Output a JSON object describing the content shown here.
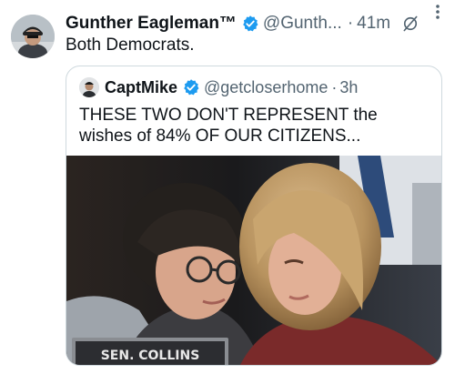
{
  "tweet": {
    "author_name": "Gunther Eagleman™",
    "handle": "@Gunth...",
    "separator": "·",
    "time": "41m",
    "text": "Both Democrats."
  },
  "quoted": {
    "author_name": "CaptMike",
    "handle": "@getcloserhome",
    "separator": "·",
    "time": "3h",
    "text": "THESE TWO DON'T REPRESENT the wishes of 84% OF OUR CITIZENS...",
    "photo": {
      "nameplate": "SEN. COLLINS"
    }
  },
  "icons": {
    "verified": "verified-badge-icon",
    "grok": "grok-icon",
    "more": "more-options-icon"
  },
  "colors": {
    "verified": "#1d9bf0",
    "secondary_text": "#536471",
    "border": "#cfd9de"
  }
}
